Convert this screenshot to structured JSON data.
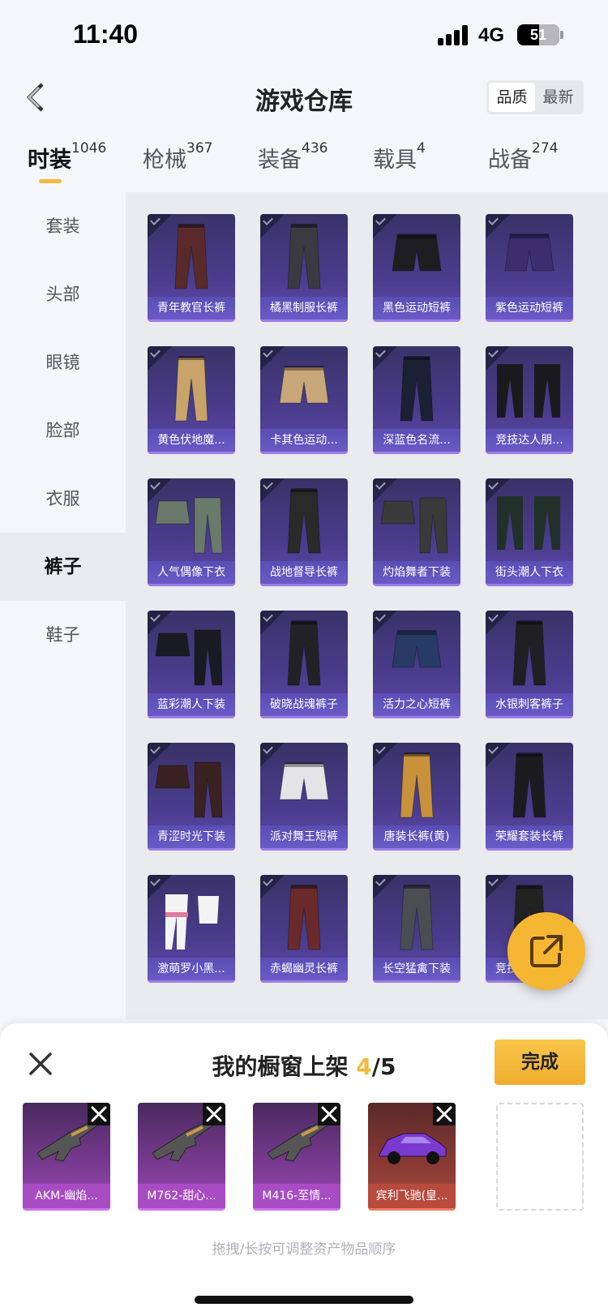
{
  "status_bar": {
    "time": "11:40",
    "network": "4G",
    "battery": "51",
    "battery_level": 0.51
  },
  "header": {
    "title": "游戏仓库",
    "sort_options": [
      "品质",
      "最新"
    ],
    "sort_active": 0
  },
  "tabs": [
    {
      "label": "时装",
      "count": "1046",
      "active": true
    },
    {
      "label": "枪械",
      "count": "367"
    },
    {
      "label": "装备",
      "count": "436"
    },
    {
      "label": "载具",
      "count": "4"
    },
    {
      "label": "战备",
      "count": "274"
    }
  ],
  "sidebar": {
    "items": [
      "套装",
      "头部",
      "眼镜",
      "脸部",
      "衣服",
      "裤子",
      "鞋子"
    ],
    "active_index": 5
  },
  "items": [
    {
      "name": "青年教官长裤",
      "icon": "long-pants-icon",
      "color": "#5a2a2a"
    },
    {
      "name": "橘黑制服长裤",
      "icon": "long-pants-icon",
      "color": "#3a3a40"
    },
    {
      "name": "黑色运动短裤",
      "icon": "shorts-icon",
      "color": "#1e1e22"
    },
    {
      "name": "紫色运动短裤",
      "icon": "shorts-icon",
      "color": "#3c2e6e"
    },
    {
      "name": "黄色伏地魔...",
      "icon": "long-pants-icon",
      "color": "#c8a46a"
    },
    {
      "name": "卡其色运动...",
      "icon": "shorts-icon",
      "color": "#c8a878"
    },
    {
      "name": "深蓝色名流...",
      "icon": "long-pants-icon",
      "color": "#1c2034"
    },
    {
      "name": "竞技达人朋...",
      "icon": "boots-pants-icon",
      "color": "#1a1a1e"
    },
    {
      "name": "人气偶像下衣",
      "icon": "skirt-pants-icon",
      "color": "#6a7a6a"
    },
    {
      "name": "战地督导长裤",
      "icon": "long-pants-icon",
      "color": "#2a2a28"
    },
    {
      "name": "灼焰舞者下装",
      "icon": "skirt-pants-icon",
      "color": "#3a3a3a"
    },
    {
      "name": "街头潮人下衣",
      "icon": "boots-pants-icon",
      "color": "#22302a"
    },
    {
      "name": "蓝彩潮人下装",
      "icon": "skirt-pants-icon",
      "color": "#1a1a22"
    },
    {
      "name": "破晓战魂裤子",
      "icon": "long-pants-icon",
      "color": "#222226"
    },
    {
      "name": "活力之心短裤",
      "icon": "shorts-icon",
      "color": "#283a66"
    },
    {
      "name": "水银刺客裤子",
      "icon": "long-pants-icon",
      "color": "#202024"
    },
    {
      "name": "青涩时光下装",
      "icon": "skirt-pants-icon",
      "color": "#3a2222"
    },
    {
      "name": "派对舞王短裤",
      "icon": "shorts-icon",
      "color": "#e4e4e6"
    },
    {
      "name": "唐装长裤(黄)",
      "icon": "long-pants-icon",
      "color": "#c8923a"
    },
    {
      "name": "荣耀套装长裤",
      "icon": "long-pants-icon",
      "color": "#1c1c20"
    },
    {
      "name": "激萌罗小黑...",
      "icon": "stockings-icon",
      "color": "#f4f4f4"
    },
    {
      "name": "赤蝎幽灵长裤",
      "icon": "long-pants-icon",
      "color": "#6a2a2a"
    },
    {
      "name": "长空猛禽下装",
      "icon": "long-pants-icon",
      "color": "#4a4e52"
    },
    {
      "name": "竞技名士长裤",
      "icon": "long-pants-icon",
      "color": "#222"
    }
  ],
  "fab": {
    "icon": "share-icon"
  },
  "showcase": {
    "title_prefix": "我的橱窗上架 ",
    "current": "4",
    "total": "/5",
    "done_label": "完成",
    "close_icon": "close-icon",
    "slots": [
      {
        "name": "AKM-幽焰...",
        "icon": "rifle-icon",
        "tier": "purple"
      },
      {
        "name": "M762-甜心...",
        "icon": "rifle-icon",
        "tier": "purple"
      },
      {
        "name": "M416-至情...",
        "icon": "rifle-icon",
        "tier": "purple"
      },
      {
        "name": "宾利飞驰(皇...",
        "icon": "car-icon",
        "tier": "red"
      }
    ],
    "hint": "拖拽/长按可调整资产物品顺序"
  }
}
